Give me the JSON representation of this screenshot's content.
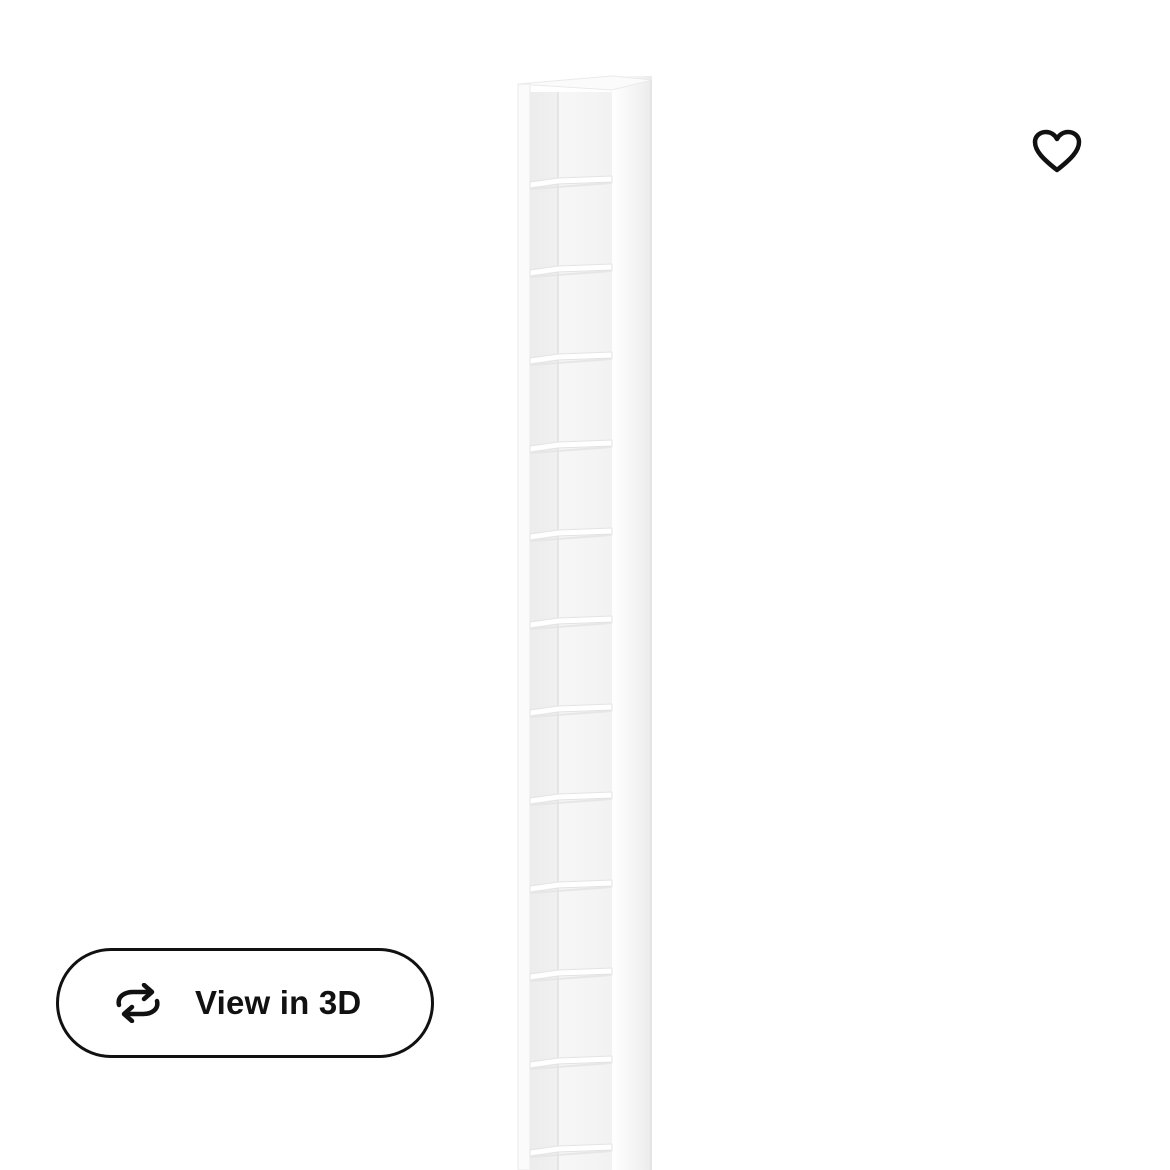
{
  "product": {
    "shelf_count": 12,
    "colors": {
      "background": "#ffffff",
      "shelf_body": "#f6f6f6",
      "shelf_shadow": "#e2e2e2",
      "shelf_edge": "#ffffff",
      "ink": "#111111"
    }
  },
  "actions": {
    "favourite_icon": "heart-outline-icon",
    "view3d_icon": "rotate-3d-icon",
    "view3d_label": "View in 3D"
  }
}
